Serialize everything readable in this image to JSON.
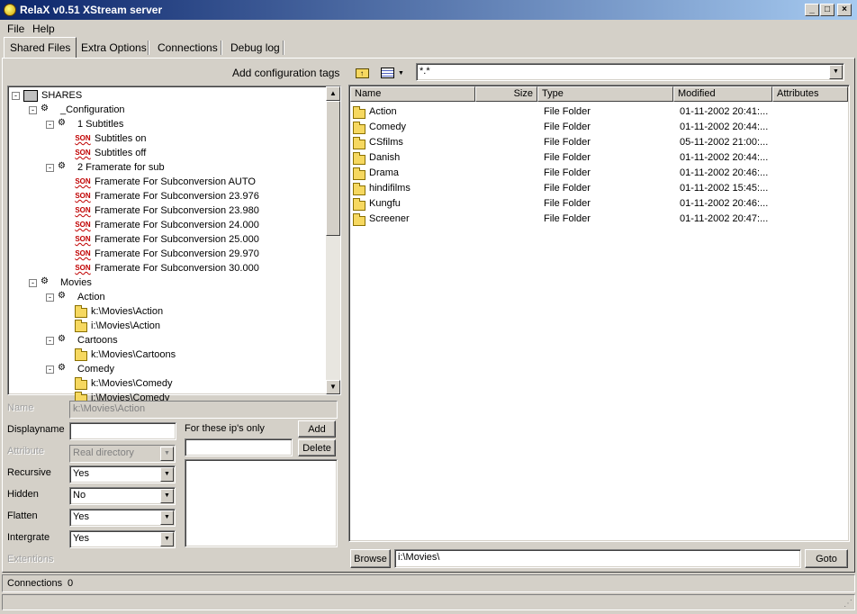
{
  "window": {
    "title": "RelaX v0.51 XStream server"
  },
  "menu": {
    "file": "File",
    "help": "Help"
  },
  "tabs": [
    "Shared Files",
    "Extra Options",
    "Connections",
    "Debug log"
  ],
  "left": {
    "add_config_tags": "Add configuration tags",
    "tree": [
      {
        "label": "SHARES",
        "icon": "computer-icon",
        "expander": "-",
        "level": 0
      },
      {
        "label": "_Configuration",
        "icon": "config-icon",
        "expander": "-",
        "level": 1
      },
      {
        "label": "1 Subtitles",
        "icon": "config-icon",
        "expander": "-",
        "level": 2
      },
      {
        "label": "Subtitles on",
        "icon": "son-icon",
        "level": 3
      },
      {
        "label": "Subtitles off",
        "icon": "son-icon",
        "level": 3
      },
      {
        "label": "2 Framerate for sub",
        "icon": "config-icon",
        "expander": "-",
        "level": 2
      },
      {
        "label": "Framerate For Subconversion AUTO",
        "icon": "son-icon",
        "level": 3
      },
      {
        "label": "Framerate For Subconversion 23.976",
        "icon": "son-icon",
        "level": 3
      },
      {
        "label": "Framerate For Subconversion 23.980",
        "icon": "son-icon",
        "level": 3
      },
      {
        "label": "Framerate For Subconversion 24.000",
        "icon": "son-icon",
        "level": 3
      },
      {
        "label": "Framerate For Subconversion 25.000",
        "icon": "son-icon",
        "level": 3
      },
      {
        "label": "Framerate For Subconversion 29.970",
        "icon": "son-icon",
        "level": 3
      },
      {
        "label": "Framerate For Subconversion 30.000",
        "icon": "son-icon",
        "level": 3
      },
      {
        "label": "Movies",
        "icon": "config-icon",
        "expander": "-",
        "level": 1
      },
      {
        "label": "Action",
        "icon": "config-icon",
        "expander": "-",
        "level": 2
      },
      {
        "label": "k:\\Movies\\Action",
        "icon": "folder-icon",
        "level": 3
      },
      {
        "label": "i:\\Movies\\Action",
        "icon": "folder-icon",
        "level": 3
      },
      {
        "label": "Cartoons",
        "icon": "config-icon",
        "expander": "-",
        "level": 2
      },
      {
        "label": "k:\\Movies\\Cartoons",
        "icon": "folder-icon",
        "level": 3
      },
      {
        "label": "Comedy",
        "icon": "config-icon",
        "expander": "-",
        "level": 2
      },
      {
        "label": "k:\\Movies\\Comedy",
        "icon": "folder-icon",
        "level": 3
      },
      {
        "label": "i:\\Movies\\Comedy",
        "icon": "folder-icon",
        "level": 3
      }
    ],
    "form": {
      "name_label": "Name",
      "name_value": "k:\\Movies\\Action",
      "displayname_label": "Displayname",
      "displayname_value": "",
      "attribute_label": "Attribute",
      "attribute_value": "Real directory",
      "recursive_label": "Recursive",
      "recursive_value": "Yes",
      "hidden_label": "Hidden",
      "hidden_value": "No",
      "flatten_label": "Flatten",
      "flatten_value": "Yes",
      "intergrate_label": "Intergrate",
      "intergrate_value": "Yes",
      "extentions_label": "Extentions",
      "ips_label": "For these ip's only",
      "ip_value": "",
      "add_button": "Add",
      "delete_button": "Delete"
    }
  },
  "right": {
    "filter": "*.*",
    "columns": [
      "Name",
      "Size",
      "Type",
      "Modified",
      "Attributes"
    ],
    "files": [
      {
        "name": "Action",
        "size": "",
        "type": "File Folder",
        "modified": "01-11-2002 20:41:..."
      },
      {
        "name": "Comedy",
        "size": "",
        "type": "File Folder",
        "modified": "01-11-2002 20:44:..."
      },
      {
        "name": "CSfilms",
        "size": "",
        "type": "File Folder",
        "modified": "05-11-2002 21:00:..."
      },
      {
        "name": "Danish",
        "size": "",
        "type": "File Folder",
        "modified": "01-11-2002 20:44:..."
      },
      {
        "name": "Drama",
        "size": "",
        "type": "File Folder",
        "modified": "01-11-2002 20:46:..."
      },
      {
        "name": "hindifilms",
        "size": "",
        "type": "File Folder",
        "modified": "01-11-2002 15:45:..."
      },
      {
        "name": "Kungfu",
        "size": "",
        "type": "File Folder",
        "modified": "01-11-2002 20:46:..."
      },
      {
        "name": "Screener",
        "size": "",
        "type": "File Folder",
        "modified": "01-11-2002 20:47:..."
      }
    ],
    "browse_button": "Browse",
    "path_value": "i:\\Movies\\",
    "goto_button": "Goto"
  },
  "status": {
    "connections_label": "Connections",
    "connections_count": "0"
  }
}
